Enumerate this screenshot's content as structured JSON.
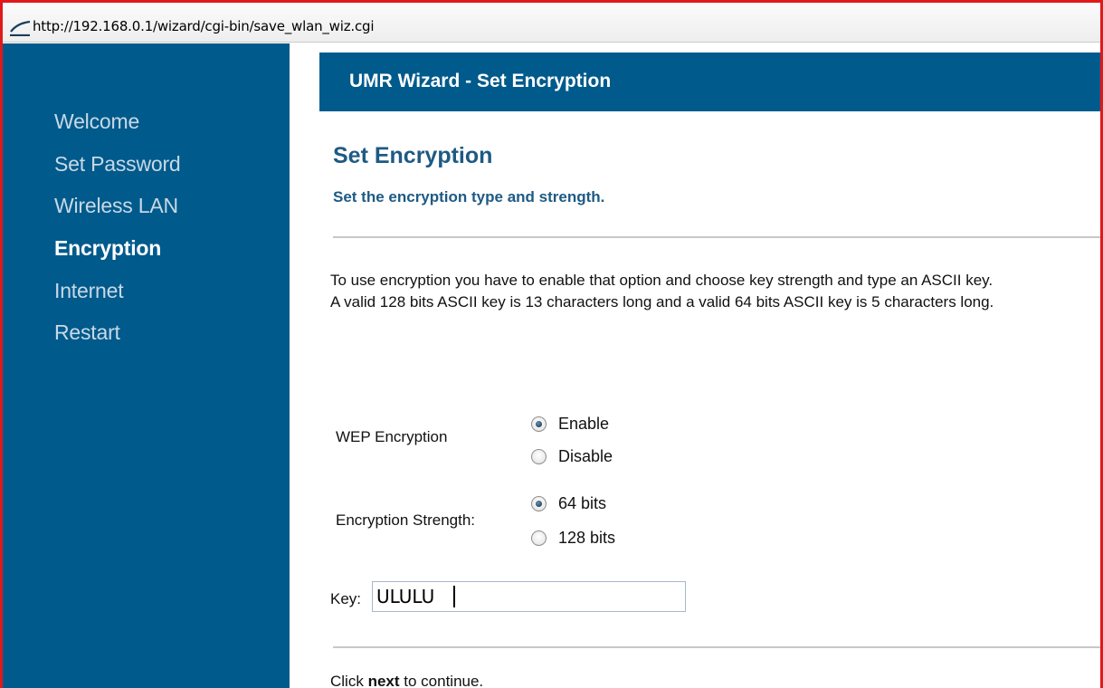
{
  "browser": {
    "url": "http://192.168.0.1/wizard/cgi-bin/save_wlan_wiz.cgi",
    "page_icon": "page-icon"
  },
  "sidebar": {
    "items": [
      {
        "label": "Welcome",
        "active": false
      },
      {
        "label": "Set Password",
        "active": false
      },
      {
        "label": "Wireless LAN",
        "active": false
      },
      {
        "label": "Encryption",
        "active": true
      },
      {
        "label": "Internet",
        "active": false
      },
      {
        "label": "Restart",
        "active": false
      }
    ]
  },
  "header": {
    "title": "UMR Wizard - Set Encryption"
  },
  "main": {
    "title": "Set Encryption",
    "subtitle": "Set the encryption type and strength.",
    "description_line1": "To use encryption you have to enable that option and choose key strength and type an ASCII key.",
    "description_line2": "A valid 128 bits ASCII key is 13 characters long and a valid 64 bits ASCII key is 5 characters long."
  },
  "form": {
    "wep_label": "WEP Encryption",
    "wep_options": [
      {
        "label": "Enable",
        "checked": true
      },
      {
        "label": "Disable",
        "checked": false
      }
    ],
    "strength_label": "Encryption Strength:",
    "strength_options": [
      {
        "label": "64 bits",
        "checked": true
      },
      {
        "label": "128 bits",
        "checked": false
      }
    ],
    "key_label": "Key:",
    "key_value": "ULULU"
  },
  "footer": {
    "pre": "Click ",
    "bold": "next",
    "post": " to continue."
  },
  "colors": {
    "sidebar": "#005a8c",
    "header": "#005a8c",
    "accent_text": "#1e5a84",
    "frame_border": "#e0191b"
  }
}
